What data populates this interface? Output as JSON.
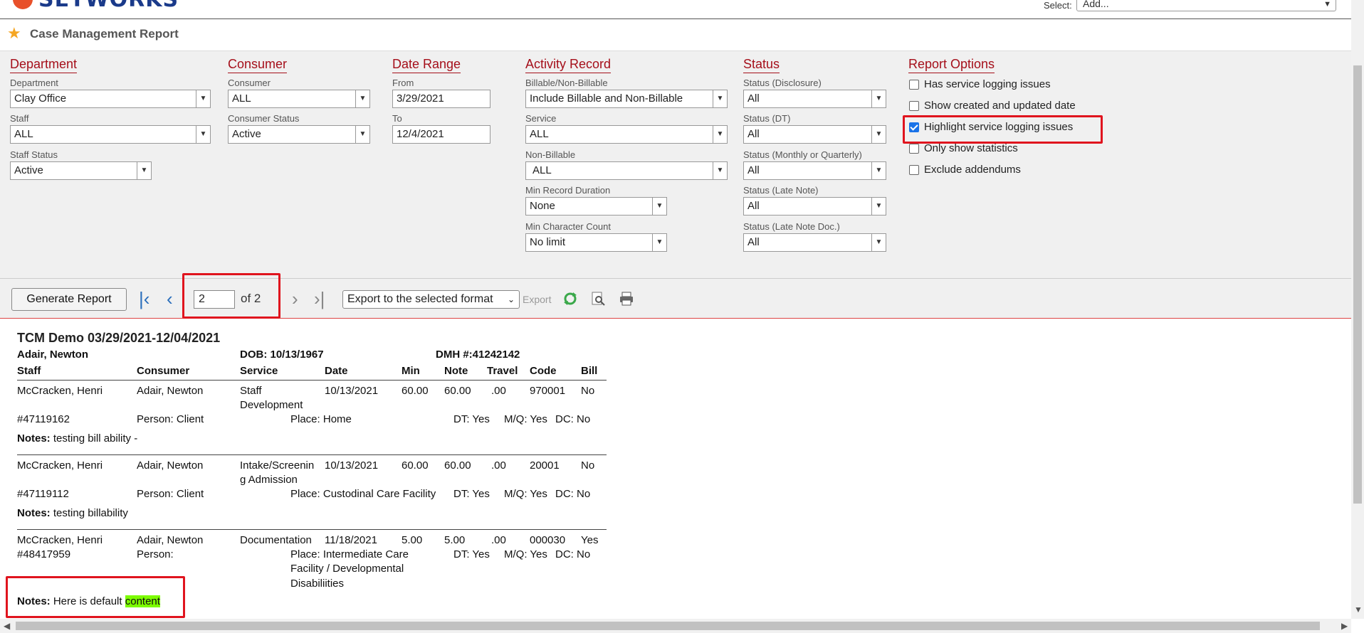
{
  "topbar": {
    "logo_text": "SETWORKS",
    "select_label": "Select:",
    "select_value": "Add..."
  },
  "header": {
    "title": "Case Management Report"
  },
  "department": {
    "group": "Department",
    "dept_label": "Department",
    "dept_value": "Clay Office",
    "staff_label": "Staff",
    "staff_value": "ALL",
    "staff_status_label": "Staff Status",
    "staff_status_value": "Active"
  },
  "consumer": {
    "group": "Consumer",
    "consumer_label": "Consumer",
    "consumer_value": "ALL",
    "status_label": "Consumer Status",
    "status_value": "Active"
  },
  "date_range": {
    "group": "Date Range",
    "from_label": "From",
    "from_value": "3/29/2021",
    "to_label": "To",
    "to_value": "12/4/2021"
  },
  "activity": {
    "group": "Activity Record",
    "billable_label": "Billable/Non-Billable",
    "billable_value": "Include Billable and Non-Billable",
    "service_label": "Service",
    "service_value": "ALL",
    "nonbill_label": "Non-Billable",
    "nonbill_value": "ALL",
    "duration_label": "Min Record Duration",
    "duration_value": "None",
    "charcount_label": "Min Character Count",
    "charcount_value": "No limit"
  },
  "status": {
    "group": "Status",
    "disclosure_label": "Status (Disclosure)",
    "disclosure_value": "All",
    "dt_label": "Status (DT)",
    "dt_value": "All",
    "mq_label": "Status (Monthly or Quarterly)",
    "mq_value": "All",
    "late_label": "Status (Late Note)",
    "late_value": "All",
    "latedoc_label": "Status (Late Note Doc.)",
    "latedoc_value": "All"
  },
  "options": {
    "group": "Report Options",
    "items": [
      {
        "label": "Has service logging issues",
        "checked": false
      },
      {
        "label": "Show created and updated date",
        "checked": false
      },
      {
        "label": "Highlight service logging issues",
        "checked": true
      },
      {
        "label": "Only show statistics",
        "checked": false
      },
      {
        "label": "Exclude addendums",
        "checked": false
      }
    ]
  },
  "toolbar": {
    "generate": "Generate Report",
    "page_value": "2",
    "page_of": "of 2",
    "export_format": "Export to the selected format",
    "export_label": "Export"
  },
  "report": {
    "title": "TCM Demo  03/29/2021-12/04/2021",
    "client": "Adair, Newton",
    "dob": "DOB: 10/13/1967",
    "dmh": "DMH #:41242142",
    "headers": [
      "Staff",
      "Consumer",
      "Service",
      "Date",
      "Min",
      "Note",
      "Travel",
      "Code",
      "Bill"
    ],
    "records": [
      {
        "staff": "McCracken, Henri",
        "consumer": "Adair, Newton",
        "service1": "Staff",
        "service2": "Development",
        "date": "10/13/2021",
        "min": "60.00",
        "note": "60.00",
        "travel": ".00",
        "code": "970001",
        "bill": "No",
        "id": "#47119162",
        "person": "Person: Client",
        "place1": "Place: Home",
        "place2": "",
        "place3": "",
        "dt": "DT: Yes",
        "mq": "M/Q: Yes",
        "dc": "DC: No",
        "notes_label": "Notes:",
        "notes": " testing bill ability -",
        "notes_hl": ""
      },
      {
        "staff": "McCracken, Henri",
        "consumer": "Adair, Newton",
        "service1": "Intake/Screenin",
        "service2": "g Admission",
        "date": "10/13/2021",
        "min": "60.00",
        "note": "60.00",
        "travel": ".00",
        "code": "20001",
        "bill": "No",
        "id": "#47119112",
        "person": "Person: Client",
        "place1": "Place: Custodinal Care Facility",
        "place2": "",
        "place3": "",
        "dt": "DT: Yes",
        "mq": "M/Q: Yes",
        "dc": "DC: No",
        "notes_label": "Notes:",
        "notes": " testing billability",
        "notes_hl": ""
      },
      {
        "staff": "McCracken, Henri",
        "consumer": "Adair, Newton",
        "service1": "Documentation",
        "service2": "",
        "date": "11/18/2021",
        "min": "5.00",
        "note": "5.00",
        "travel": ".00",
        "code": "000030",
        "bill": "Yes",
        "id": "#48417959",
        "person": "Person:",
        "place1": "Place: Intermediate Care",
        "place2": "Facility / Developmental",
        "place3": "Disabiliities",
        "dt": "DT: Yes",
        "mq": "M/Q: Yes",
        "dc": "DC: No",
        "notes_label": "Notes:",
        "notes": " Here is default ",
        "notes_hl": "content"
      }
    ]
  },
  "colors": {
    "accent": "#a50f1a",
    "highlight_box": "#e0141e",
    "highlight_text": "#7cfc00",
    "nav_blue": "#2a6ebb"
  }
}
